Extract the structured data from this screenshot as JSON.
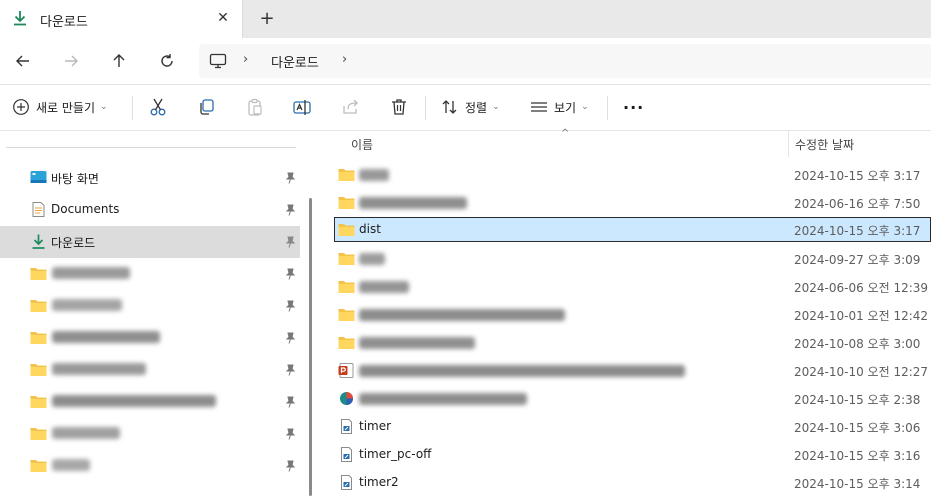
{
  "tab": {
    "title": "다운로드",
    "close": "✕",
    "new_tab": "+"
  },
  "address": {
    "separator": "›",
    "crumb": "다운로드"
  },
  "toolbar": {
    "new_label": "새로 만들기",
    "sort_label": "정렬",
    "view_label": "보기",
    "more": "···"
  },
  "sidebar": {
    "items": [
      {
        "label": "바탕 화면",
        "icon": "desktop-icon"
      },
      {
        "label": "Documents",
        "icon": "document-icon"
      },
      {
        "label": "다운로드",
        "icon": "download-icon"
      }
    ]
  },
  "columns": {
    "name": "이름",
    "date": "수정한 날짜",
    "sort_glyph": "^"
  },
  "files": [
    {
      "name": "",
      "date": "2024-10-15 오후 3:17",
      "icon": "folder-icon"
    },
    {
      "name": "",
      "date": "2024-06-16 오후 7:50",
      "icon": "folder-icon"
    },
    {
      "name": "dist",
      "date": "2024-10-15 오후 3:17",
      "icon": "folder-icon"
    },
    {
      "name": "",
      "date": "2024-09-27 오후 3:09",
      "icon": "folder-icon"
    },
    {
      "name": "",
      "date": "2024-06-06 오전 12:39",
      "icon": "folder-icon"
    },
    {
      "name": "",
      "date": "2024-10-01 오전 12:42",
      "icon": "folder-icon"
    },
    {
      "name": "",
      "date": "2024-10-08 오후 3:00",
      "icon": "folder-icon"
    },
    {
      "name": "",
      "date": "2024-10-10 오전 12:27",
      "icon": "powerpoint-icon"
    },
    {
      "name": "",
      "date": "2024-10-15 오후 2:38",
      "icon": "app-icon"
    },
    {
      "name": "timer",
      "date": "2024-10-15 오후 3:06",
      "icon": "shortcut-file-icon"
    },
    {
      "name": "timer_pc-off",
      "date": "2024-10-15 오후 3:16",
      "icon": "shortcut-file-icon"
    },
    {
      "name": "timer2",
      "date": "2024-10-15 오후 3:14",
      "icon": "shortcut-file-icon"
    }
  ],
  "colors": {
    "selection": "#cce8ff",
    "accent_green": "#1e8a5a",
    "folder": "#f3c44b"
  }
}
